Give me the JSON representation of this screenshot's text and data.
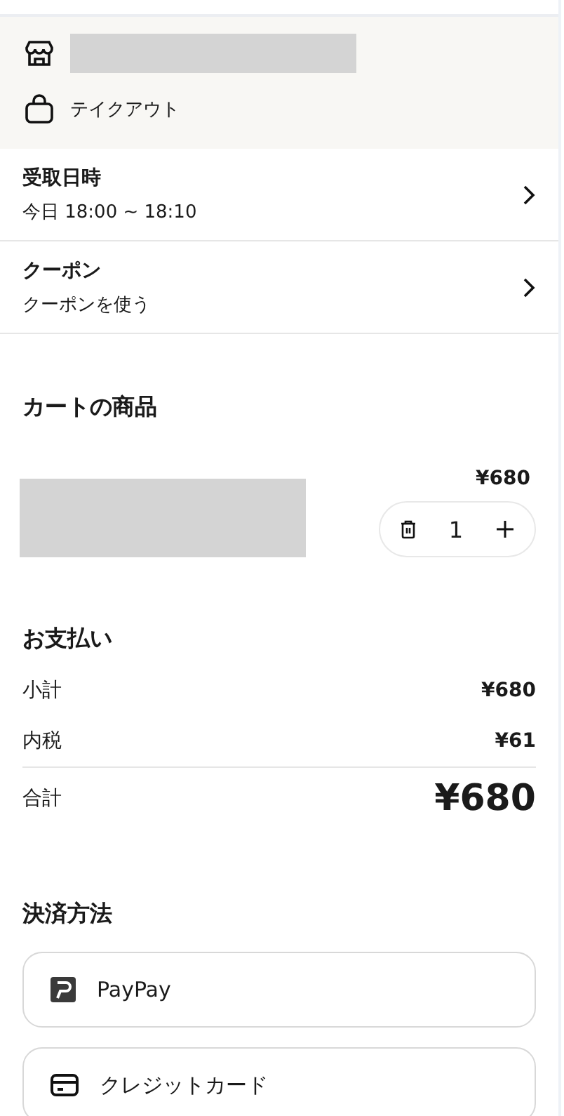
{
  "store": {
    "service": "テイクアウト"
  },
  "options": [
    {
      "title": "受取日時",
      "value": "今日 18:00 ~ 18:10"
    },
    {
      "title": "クーポン",
      "value": "クーポンを使う"
    }
  ],
  "cart": {
    "heading": "カートの商品",
    "items": [
      {
        "price": "¥680",
        "quantity": "1"
      }
    ]
  },
  "payment": {
    "heading": "お支払い",
    "rows": [
      {
        "label": "小計",
        "amount": "¥680",
        "kind": "line"
      },
      {
        "label": "内税",
        "amount": "¥61",
        "kind": "line"
      },
      {
        "label": "合計",
        "amount": "¥680",
        "kind": "total"
      }
    ]
  },
  "methods": {
    "heading": "決済方法",
    "items": [
      {
        "label": "PayPay",
        "kind": "paypay"
      },
      {
        "label": "クレジットカード",
        "kind": "card"
      }
    ]
  }
}
